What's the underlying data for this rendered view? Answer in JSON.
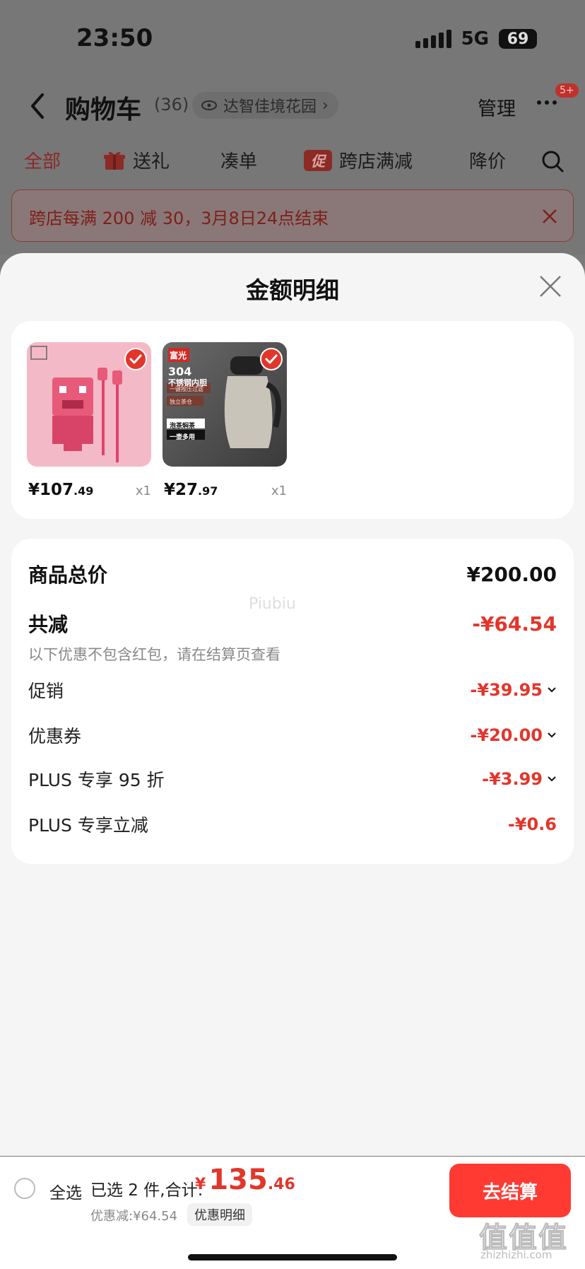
{
  "status": {
    "time": "23:50",
    "network": "5G",
    "battery": "69"
  },
  "nav": {
    "title": "购物车",
    "count": "(36)",
    "address": "达智佳境花园",
    "address_arrow": "›",
    "manage": "管理",
    "badge": "5+"
  },
  "tabs": [
    {
      "label": "全部",
      "icon": ""
    },
    {
      "label": "送礼",
      "icon": "gift-icon"
    },
    {
      "label": "凑单",
      "icon": ""
    },
    {
      "label": "跨店满减",
      "icon": "promo-badge",
      "badge": "促"
    },
    {
      "label": "降价",
      "icon": ""
    }
  ],
  "promo": {
    "text": "跨店每满 200 减 30，3月8日24点结束"
  },
  "sheet": {
    "title": "金额明细",
    "products": [
      {
        "price_int": "¥107",
        "price_dec": ".49",
        "qty": "x1",
        "tag": ""
      },
      {
        "price_int": "¥27",
        "price_dec": ".97",
        "qty": "x1",
        "tag": "富光",
        "spec": "304",
        "spec2": "不锈钢内胆",
        "line1": "一键按压过滤",
        "line2": "独立茶仓",
        "line3": "泡茶焖茶",
        "line4": "一壶多用"
      }
    ],
    "summary": {
      "total_label": "商品总价",
      "total_value": "¥200.00",
      "discount_label": "共减",
      "discount_value": "-¥64.54",
      "note": "以下优惠不包含红包，请在结算页查看",
      "watermark": "Piubiu",
      "items": [
        {
          "label": "促销",
          "value": "-¥39.95",
          "expandable": true
        },
        {
          "label": "优惠券",
          "value": "-¥20.00",
          "expandable": true
        },
        {
          "label": "PLUS 专享 95 折",
          "value": "-¥3.99",
          "expandable": true
        },
        {
          "label": "PLUS 专享立减",
          "value": "-¥0.6",
          "expandable": false
        }
      ]
    }
  },
  "bottom": {
    "select_all": "全选",
    "selected": "已选 2 件,合计:",
    "currency": "¥",
    "total_int": "135",
    "total_dec": ".46",
    "discount": "优惠减:¥64.54",
    "detail": "优惠明细",
    "checkout": "去结算",
    "watermark": "值值值",
    "watermark_sub": "zhizhizhi.com"
  },
  "colors": {
    "accent": "#e2362b",
    "checkout": "#fe3a33"
  }
}
